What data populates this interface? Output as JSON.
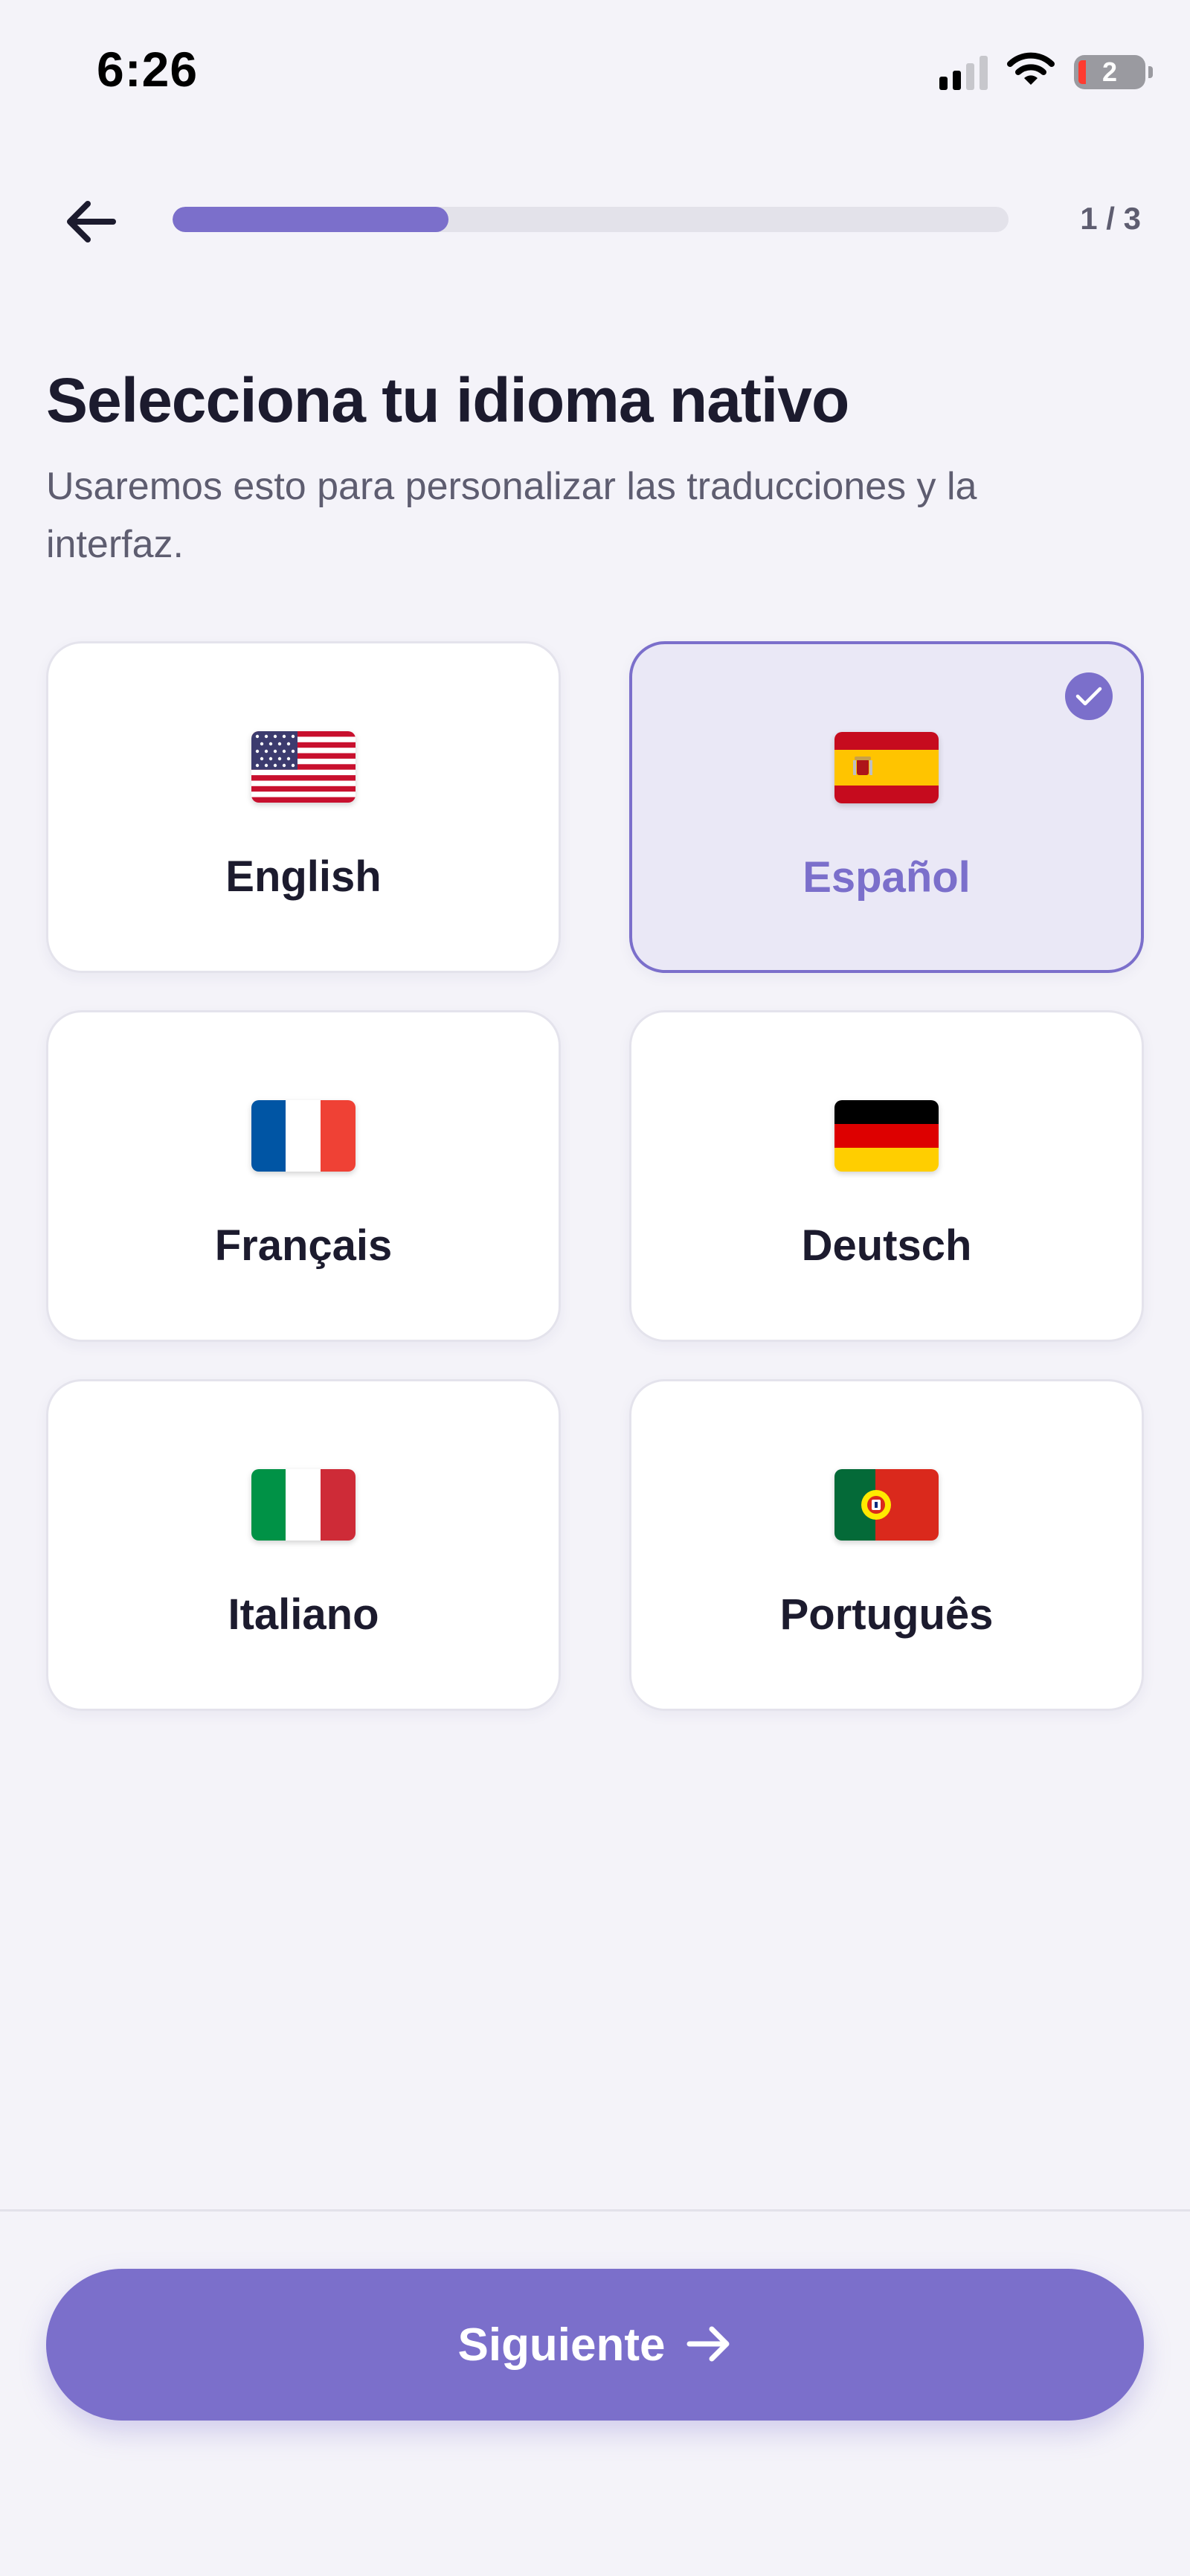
{
  "status_bar": {
    "time": "6:26",
    "battery_level": "2",
    "signal_bars_active": 2,
    "signal_bars_total": 4
  },
  "header": {
    "step_counter": "1 / 3",
    "progress_fraction": 0.33,
    "icons": {
      "back": "arrow-left-icon"
    }
  },
  "title": "Selecciona tu idioma nativo",
  "subtitle": "Usaremos esto para personalizar las traducciones y la interfaz.",
  "languages": [
    {
      "label": "English",
      "flag": "us-flag-icon",
      "selected": false
    },
    {
      "label": "Español",
      "flag": "es-flag-icon",
      "selected": true
    },
    {
      "label": "Français",
      "flag": "fr-flag-icon",
      "selected": false
    },
    {
      "label": "Deutsch",
      "flag": "de-flag-icon",
      "selected": false
    },
    {
      "label": "Italiano",
      "flag": "it-flag-icon",
      "selected": false
    },
    {
      "label": "Português",
      "flag": "pt-flag-icon",
      "selected": false
    }
  ],
  "next_button": {
    "label": "Siguiente",
    "icon": "arrow-right-icon"
  },
  "colors": {
    "accent": "#7b6fcb",
    "selected_card_bg": "#eae8f6",
    "background": "#f4f3f9",
    "text_primary": "#1c1b2e",
    "text_secondary": "#5e5d70"
  }
}
